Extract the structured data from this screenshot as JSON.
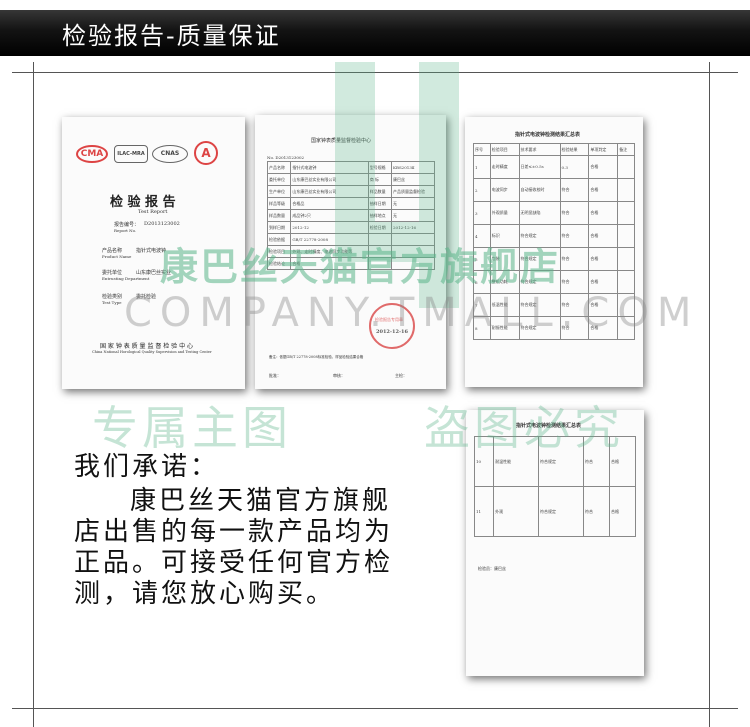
{
  "header": {
    "title": "检验报告-质量保证"
  },
  "report_cover": {
    "title_cn": "检 验 报 告",
    "title_en": "Test Report",
    "report_no_label": "报告编号：",
    "report_no_en": "Report No.",
    "report_no": "D2013123002",
    "product_label": "产品名称",
    "product_label_en": "Product Name",
    "product": "指针式电波钟",
    "dept_label": "委托单位",
    "dept_label_en": "Entrusting Department",
    "dept": "山东康巴丝实业",
    "type_label": "检验类别",
    "type_label_en": "Test Type",
    "type": "委托检验",
    "org_cn": "国 家 钟 表 质 量 监 督 检 验 中 心",
    "org_en": "China National Horological Quality Supervision and Testing Center",
    "marks": [
      "CMA",
      "CNAS",
      "ILAC-MRA",
      "A"
    ]
  },
  "report_table": {
    "org": "国家钟表质量监督检验中心",
    "report_no": "No. D2013123002",
    "rows": [
      [
        "产品名称",
        "指针式电波钟",
        "型号规格",
        "KBS2013Ⅱ"
      ],
      [
        "委托单位",
        "山东康巴丝实业有限公司",
        "商  标",
        "康巴丝"
      ],
      [
        "生产单位",
        "山东康巴丝实业有限公司",
        "样品数量",
        "产品质量监督检验"
      ],
      [
        "样品等级",
        "合格品",
        "抽样日期",
        "无"
      ],
      [
        "样品数量",
        "成品钟2只",
        "抽样地点",
        "无"
      ],
      [
        "到样日期",
        "2012-12",
        "检验日期",
        "2012-12-16"
      ],
      [
        "检验依据",
        "GB/T 22778-2008",
        "",
        ""
      ],
      [
        "检验项目",
        "外观、走时精度、电波同步功能等",
        "",
        ""
      ],
      [
        "检验结论",
        "合格",
        "",
        ""
      ]
    ],
    "stamp_text": "检验报告专用章",
    "stamp_date": "2012-12-16",
    "remark": "备注：依据GB/T 22778-2008标准检验，样品检验结果合格",
    "sign_labels": [
      "批准：",
      "审核：",
      "主检："
    ]
  },
  "summary_table_1": {
    "title": "指针式电波钟检测结果汇总表",
    "header": [
      "序号",
      "检验项目",
      "技术要求",
      "检验结果",
      "单项判定",
      "备注"
    ],
    "rows": [
      [
        "1",
        "走时精度",
        "日差≤±0.5s",
        "0.3",
        "合格",
        ""
      ],
      [
        "2",
        "电波同步",
        "自动接收校时",
        "符合",
        "合格",
        ""
      ],
      [
        "3",
        "外观质量",
        "无明显缺陷",
        "符合",
        "合格",
        ""
      ],
      [
        "4",
        "标识",
        "符合规定",
        "符合",
        "合格",
        ""
      ],
      [
        "5",
        "包装",
        "符合规定",
        "符合",
        "合格",
        ""
      ],
      [
        "6",
        "整机功耗",
        "符合规定",
        "符合",
        "合格",
        ""
      ],
      [
        "7",
        "低温性能",
        "符合规定",
        "符合",
        "合格",
        ""
      ],
      [
        "8",
        "耐振性能",
        "符合规定",
        "符合",
        "合格",
        ""
      ]
    ]
  },
  "summary_table_2": {
    "title": "指针式电波钟检测结果汇总表",
    "rows": [
      [
        "10",
        "耐温性能",
        "符合规定",
        "符合",
        "合格"
      ],
      [
        "11",
        "外观",
        "符合规定",
        "符合",
        "合格"
      ]
    ],
    "footer": "检验员：康巴丝"
  },
  "watermark": {
    "line1": "康巴丝天猫官方旗舰店",
    "line2": "COMPANY.TMALL.COM",
    "line3": "专属主图",
    "line4": "盗图必究"
  },
  "promise": {
    "heading": "我们承诺：",
    "lines": [
      "康巴丝天猫官方旗舰",
      "店出售的每一款产品均为",
      "正品。可接受任何官方检",
      "测，请您放心购买。"
    ]
  },
  "colors": {
    "banner": "#111111",
    "watermark": "#5bb58a",
    "stamp": "#d83a3a"
  }
}
